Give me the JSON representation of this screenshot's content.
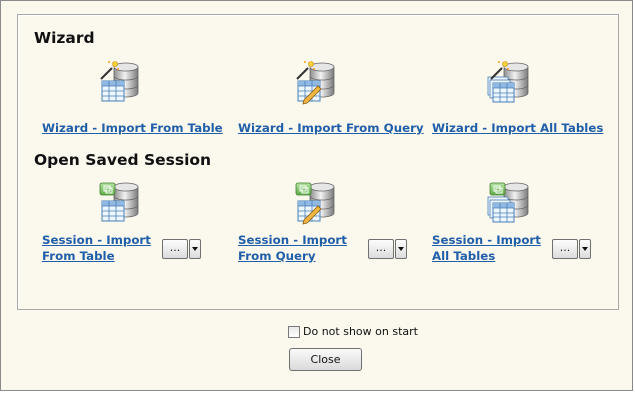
{
  "wizard": {
    "title": "Wizard",
    "items": [
      {
        "label": "Wizard - Import From Table",
        "icon": "table-database-wand-icon"
      },
      {
        "label": "Wizard - Import From Query",
        "icon": "query-database-wand-icon"
      },
      {
        "label": "Wizard - Import All Tables",
        "icon": "all-tables-database-wand-icon"
      }
    ]
  },
  "sessions": {
    "title": "Open Saved Session",
    "items": [
      {
        "label": "Session - Import From Table",
        "icon": "table-database-session-icon",
        "browse_label": "..."
      },
      {
        "label": "Session - Import From Query",
        "icon": "query-database-session-icon",
        "browse_label": "..."
      },
      {
        "label": "Session - Import All Tables",
        "icon": "all-tables-database-session-icon",
        "browse_label": "..."
      }
    ]
  },
  "footer": {
    "checkbox_label": "Do not show on start",
    "checkbox_checked": false,
    "close_label": "Close"
  },
  "colors": {
    "background": "#fbf8ee",
    "link": "#1f5ea8"
  }
}
